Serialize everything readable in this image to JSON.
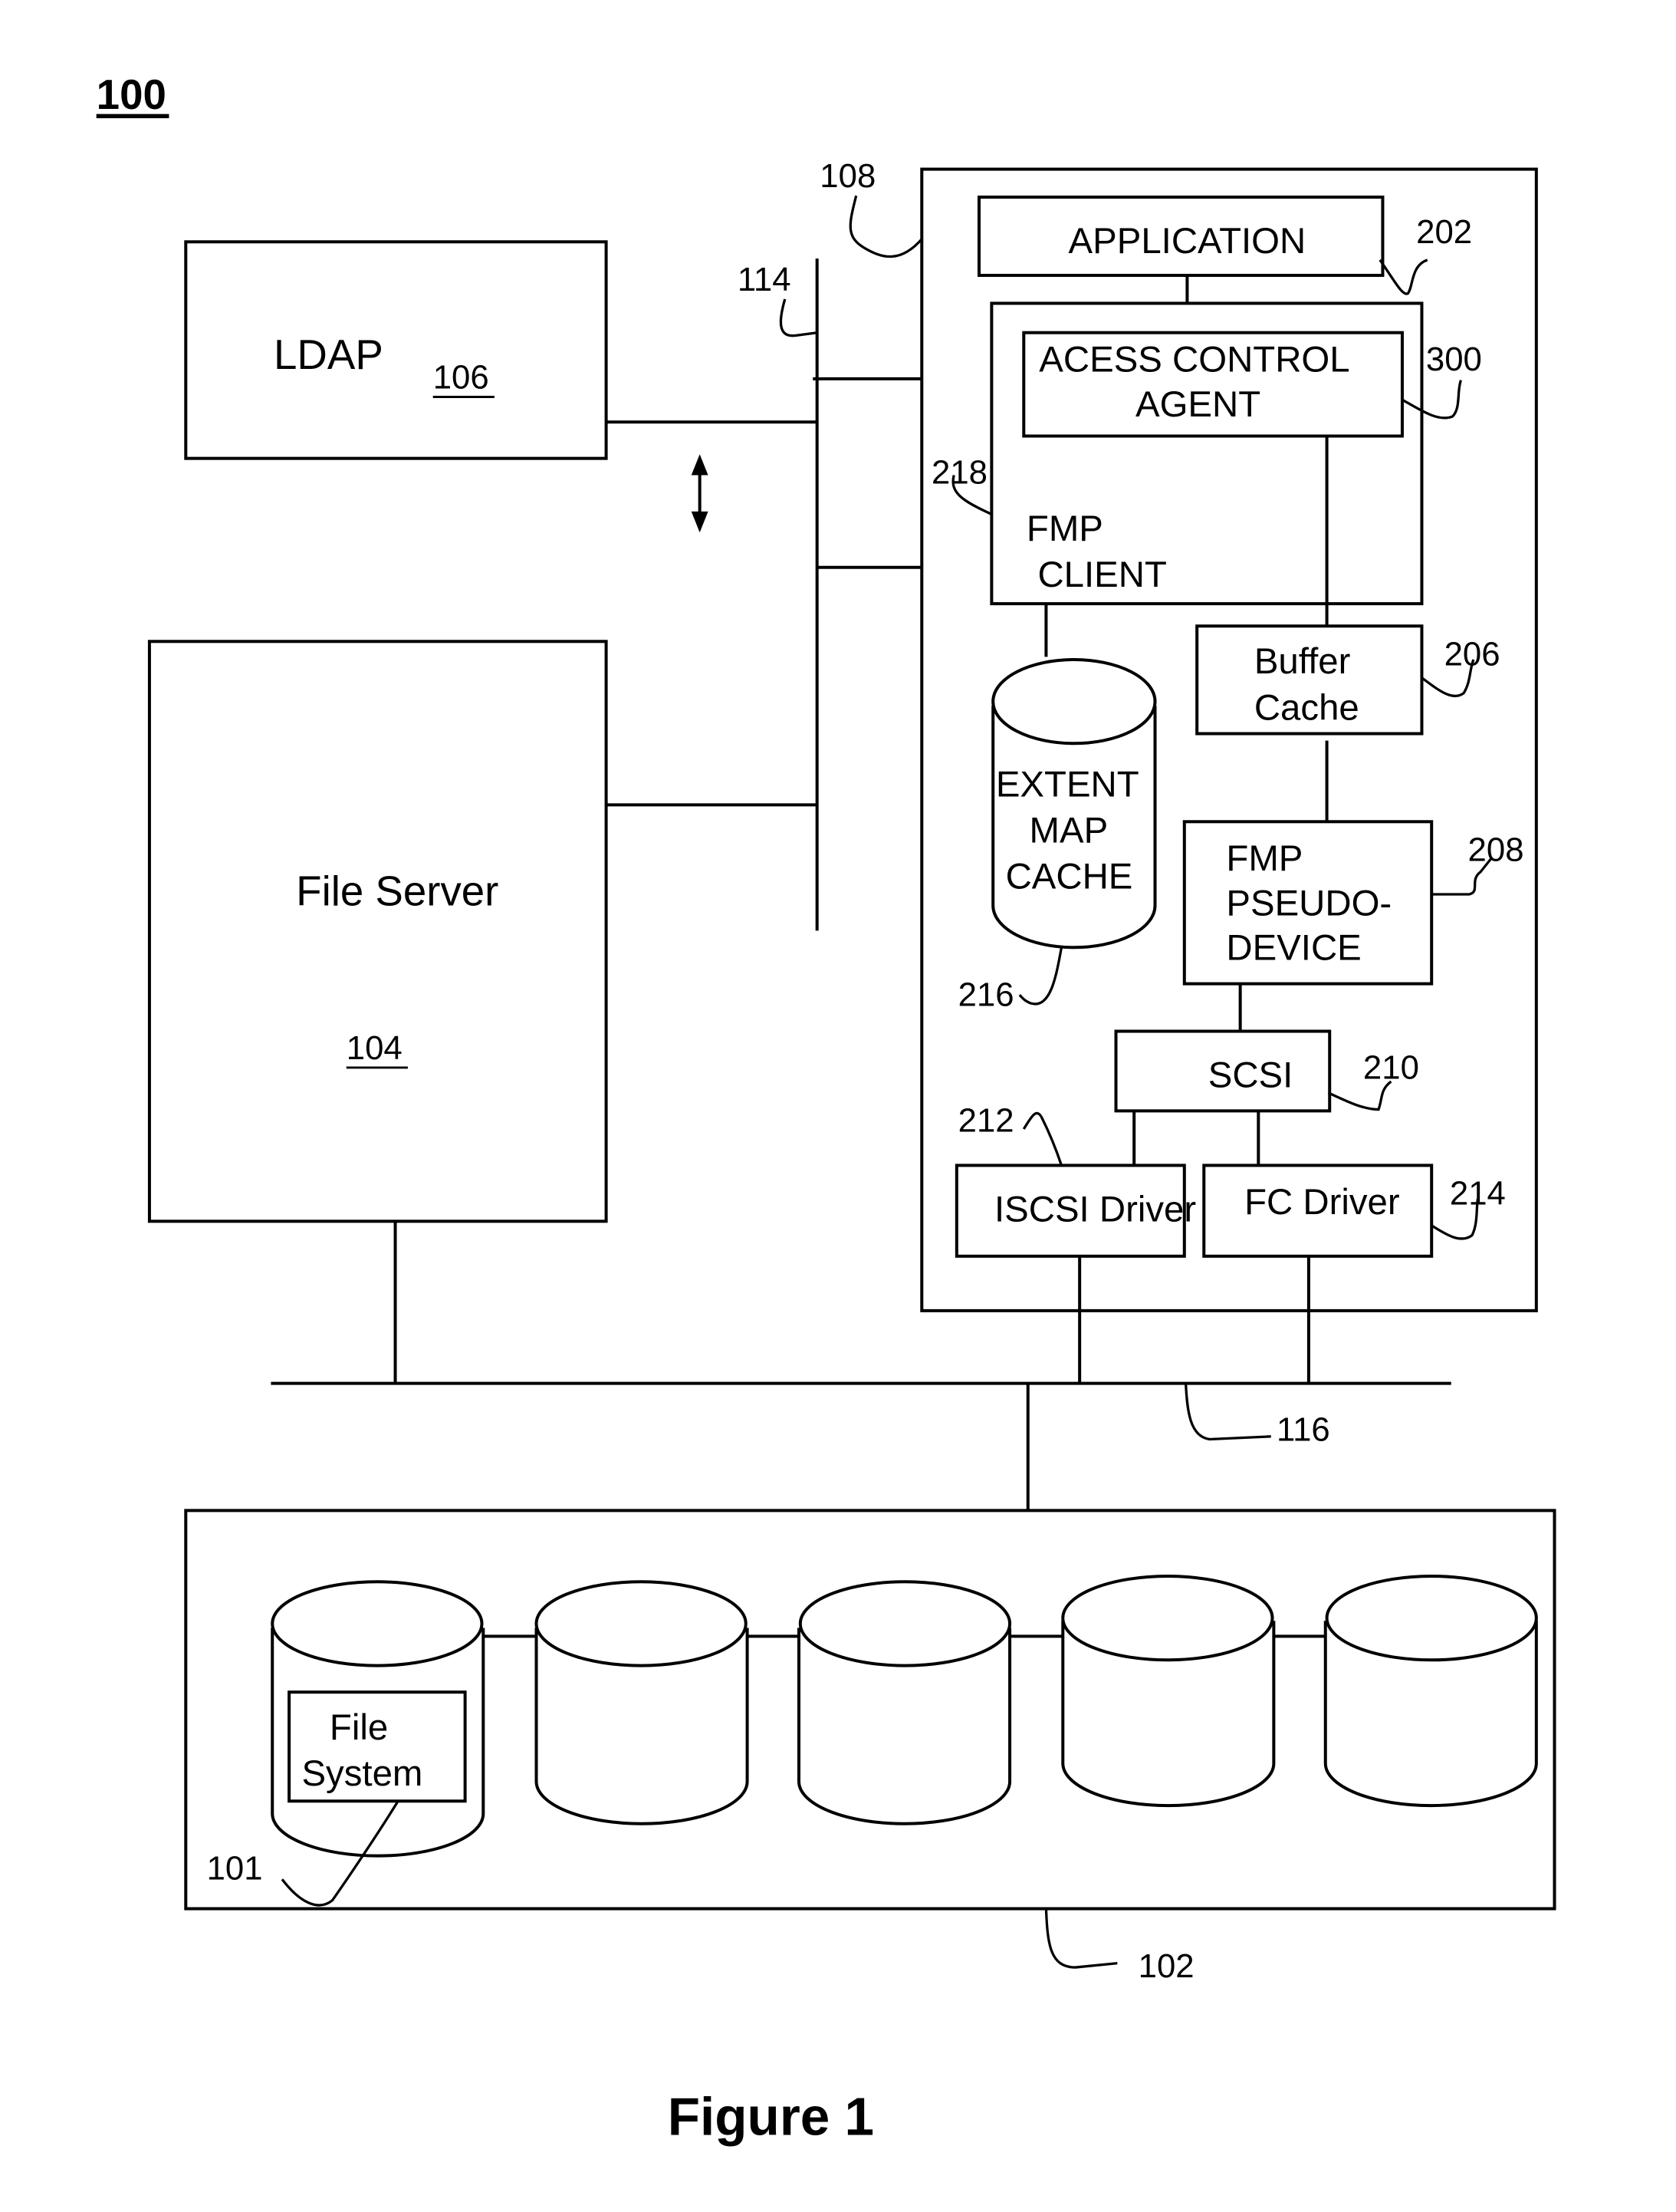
{
  "figure": {
    "number_label": "100",
    "caption": "Figure 1"
  },
  "components": {
    "ldap": {
      "label": "LDAP",
      "ref": "106"
    },
    "file_server": {
      "label": "File Server",
      "ref": "104"
    },
    "network_114": {
      "ref": "114"
    },
    "host": {
      "ref": "108"
    },
    "application": {
      "label": "APPLICATION",
      "ref": "202"
    },
    "access_control_agent": {
      "label_line1": "ACESS CONTROL",
      "label_line2": "AGENT",
      "ref": "300"
    },
    "fmp_client": {
      "label_line1": "FMP",
      "label_line2": "CLIENT",
      "ref": "218"
    },
    "extent_map_cache": {
      "label_line1": "EXTENT",
      "label_line2": "MAP",
      "label_line3": "CACHE",
      "ref": "216"
    },
    "buffer_cache": {
      "label_line1": "Buffer",
      "label_line2": "Cache",
      "ref": "206"
    },
    "fmp_pseudo_device": {
      "label_line1": "FMP",
      "label_line2": "PSEUDO-",
      "label_line3": "DEVICE",
      "ref": "208"
    },
    "scsi": {
      "label": "SCSI",
      "ref": "210"
    },
    "iscsi_driver": {
      "label": "ISCSI Driver",
      "ref": "212"
    },
    "fc_driver": {
      "label": "FC Driver",
      "ref": "214"
    },
    "san_116": {
      "ref": "116"
    },
    "storage_array": {
      "ref": "102",
      "disk_count": 5
    },
    "file_system": {
      "label_line1": "File",
      "label_line2": "System",
      "ref": "101"
    }
  }
}
